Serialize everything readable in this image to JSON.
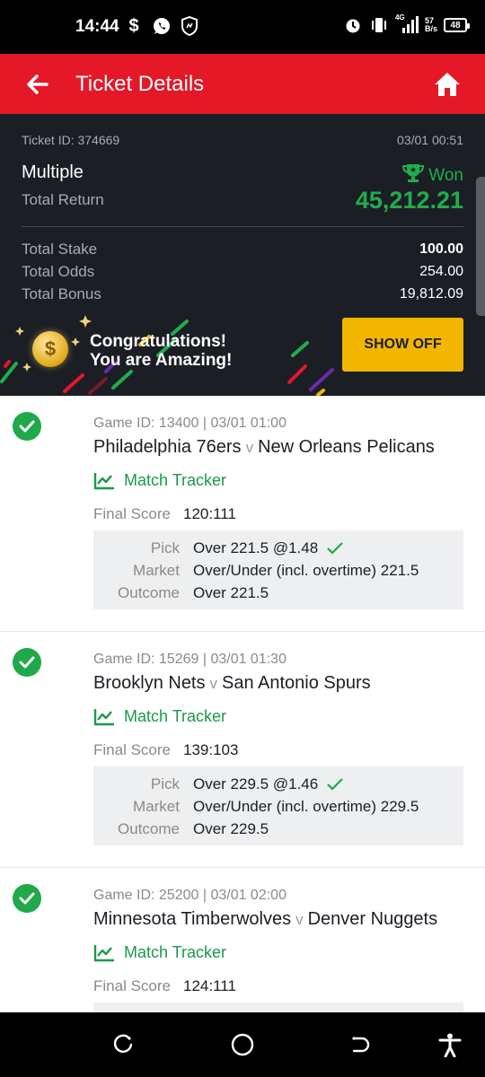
{
  "status_bar": {
    "time": "14:44",
    "network_type": "4G",
    "net_speed": "57",
    "net_unit": "B/s",
    "battery": "48"
  },
  "header": {
    "title": "Ticket Details",
    "background": "#e41827"
  },
  "ticket": {
    "id_label": "Ticket ID: 374669",
    "datetime": "03/01 00:51",
    "bet_type": "Multiple",
    "status": "Won",
    "total_return_label": "Total Return",
    "total_return": "45,212.21",
    "rows": [
      {
        "label": "Total Stake",
        "value": "100.00"
      },
      {
        "label": "Total Odds",
        "value": "254.00"
      },
      {
        "label": "Total Bonus",
        "value": "19,812.09"
      }
    ],
    "congrats_line1": "Congratulations!",
    "congrats_line2": "You are Amazing!",
    "show_off_label": "SHOW OFF"
  },
  "labels": {
    "vs": "v",
    "match_tracker": "Match Tracker",
    "final_score": "Final Score",
    "pick": "Pick",
    "market": "Market",
    "outcome": "Outcome"
  },
  "games": [
    {
      "meta": "Game ID: 13400 | 03/01 01:00",
      "home": "Philadelphia 76ers",
      "away": "New Orleans Pelicans",
      "final_score": "120:111",
      "pick": "Over 221.5 @1.48",
      "market": "Over/Under (incl. overtime) 221.5",
      "outcome": "Over 221.5"
    },
    {
      "meta": "Game ID: 15269 | 03/01 01:30",
      "home": "Brooklyn Nets",
      "away": "San Antonio Spurs",
      "final_score": "139:103",
      "pick": "Over 229.5 @1.46",
      "market": "Over/Under (incl. overtime) 229.5",
      "outcome": "Over 229.5"
    },
    {
      "meta": "Game ID: 25200 | 03/01 02:00",
      "home": "Minnesota Timberwolves",
      "away": "Denver Nuggets",
      "final_score": "124:111"
    }
  ],
  "colors": {
    "win_green": "#1fae4b",
    "panel_dark": "#1b1e25",
    "button_yellow": "#f2b500"
  }
}
